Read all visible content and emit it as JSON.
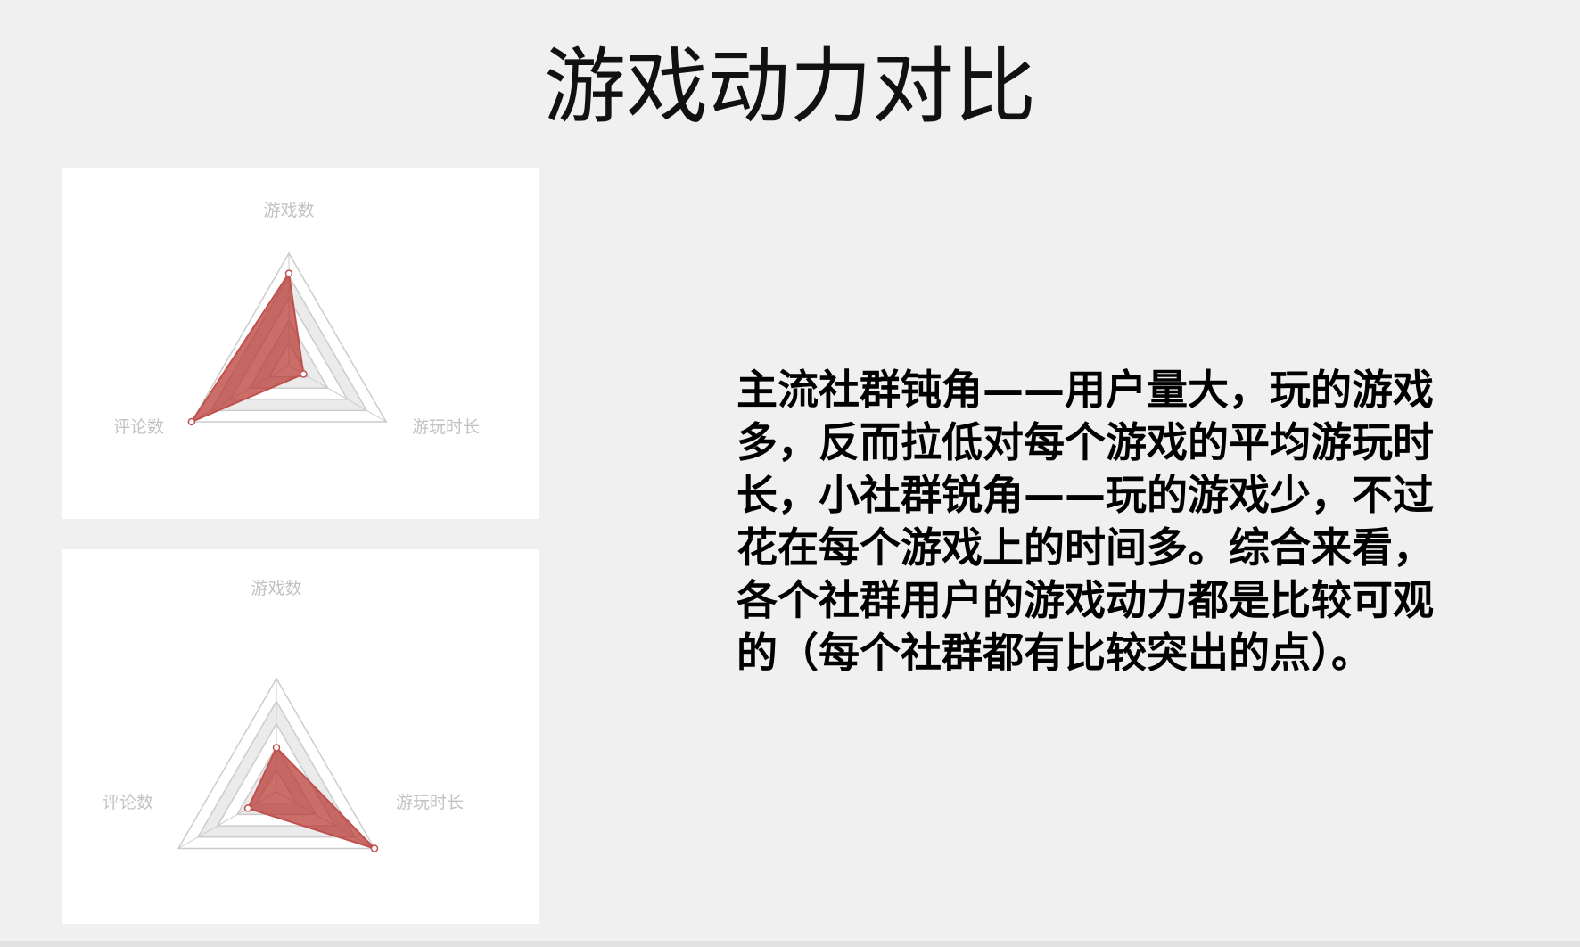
{
  "title": "游戏动力对比",
  "description": "主流社群钝角——用户量大，玩的游戏多，反而拉低对每个游戏的平均游玩时长，小社群锐角——玩的游戏少，不过花在每个游戏上的时间多。综合来看，各个社群用户的游戏动力都是比较可观的（每个社群都有比较突出的点）。",
  "colors": {
    "series_fill": "#b5302a",
    "series_stroke": "#c0504d",
    "grid_line": "#cccccc",
    "band_fill": "#ebebeb",
    "axis_label": "#c2c2c2"
  },
  "chart_data": [
    {
      "type": "radar",
      "indicators": [
        "游戏数",
        "游玩时长",
        "评论数"
      ],
      "max": 1,
      "levels": 5,
      "series": [
        {
          "values": [
            0.82,
            0.15,
            1.0
          ]
        }
      ]
    },
    {
      "type": "radar",
      "indicators": [
        "游戏数",
        "游玩时长",
        "评论数"
      ],
      "max": 1,
      "levels": 5,
      "series": [
        {
          "values": [
            0.39,
            1.0,
            0.29
          ]
        }
      ]
    }
  ]
}
